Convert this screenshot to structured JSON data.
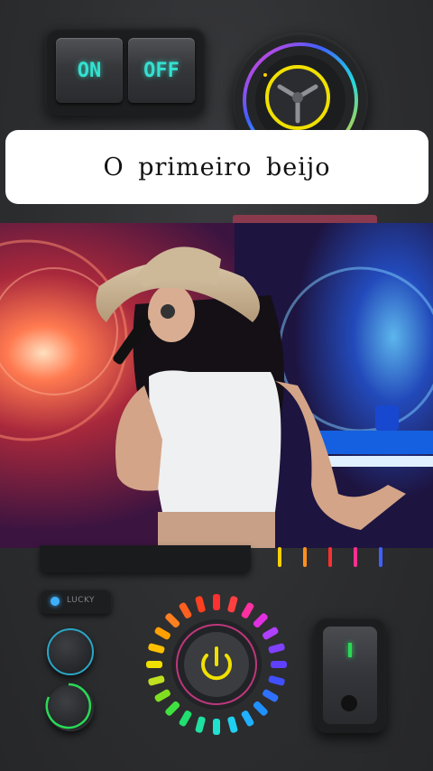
{
  "title": "O primeiro beijo",
  "switch": {
    "on_label": "ON",
    "off_label": "OFF"
  },
  "lucky_label": "LUCKY",
  "display_label": "",
  "colors": {
    "on_text": "#34e0d0",
    "knob_ring": "#f0e000",
    "power_icon": "#f0e000",
    "toggle_indicator": "#29d957",
    "lucky_led": "#3fb0ff"
  },
  "icons": [
    "steering-wheel-icon",
    "power-icon"
  ]
}
